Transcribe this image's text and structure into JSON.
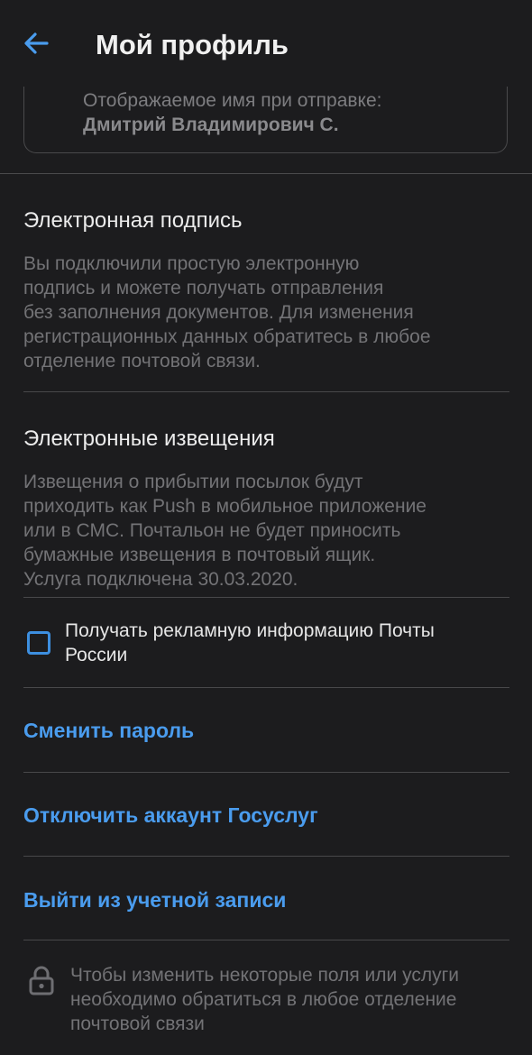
{
  "header": {
    "title": "Мой профиль",
    "back_icon": "arrow-left-icon"
  },
  "display_name": {
    "label": "Отображаемое имя при отправке:",
    "value": "Дмитрий Владимирович С."
  },
  "e_signature": {
    "title": "Электронная подпись",
    "text": "Вы подключили простую электронную\nподпись и можете получать отправления\nбез заполнения документов. Для изменения\nрегистрационных данных обратитесь в любое\nотделение почтовой связи."
  },
  "e_notifications": {
    "title": "Электронные извещения",
    "text": "Извещения о прибытии посылок будут\nприходить как Push в мобильное приложение\nили в СМС. Почтальон не будет приносить\nбумажные извещения в почтовый ящик.\nУслуга подключена 30.03.2020."
  },
  "ads_checkbox": {
    "label": "Получать рекламную информацию Почты России",
    "checked": false
  },
  "actions": {
    "change_password": "Сменить пароль",
    "disconnect_gosuslugi": "Отключить аккаунт Госуслуг",
    "logout": "Выйти из учетной записи"
  },
  "footer": {
    "note": "Чтобы изменить некоторые поля или услуги необходимо обратиться в любое отделение почтовой связи",
    "icon": "lock-icon"
  },
  "colors": {
    "background": "#1c1c1e",
    "accent": "#4a9cee",
    "divider": "#48484a",
    "muted_text": "#737376"
  }
}
